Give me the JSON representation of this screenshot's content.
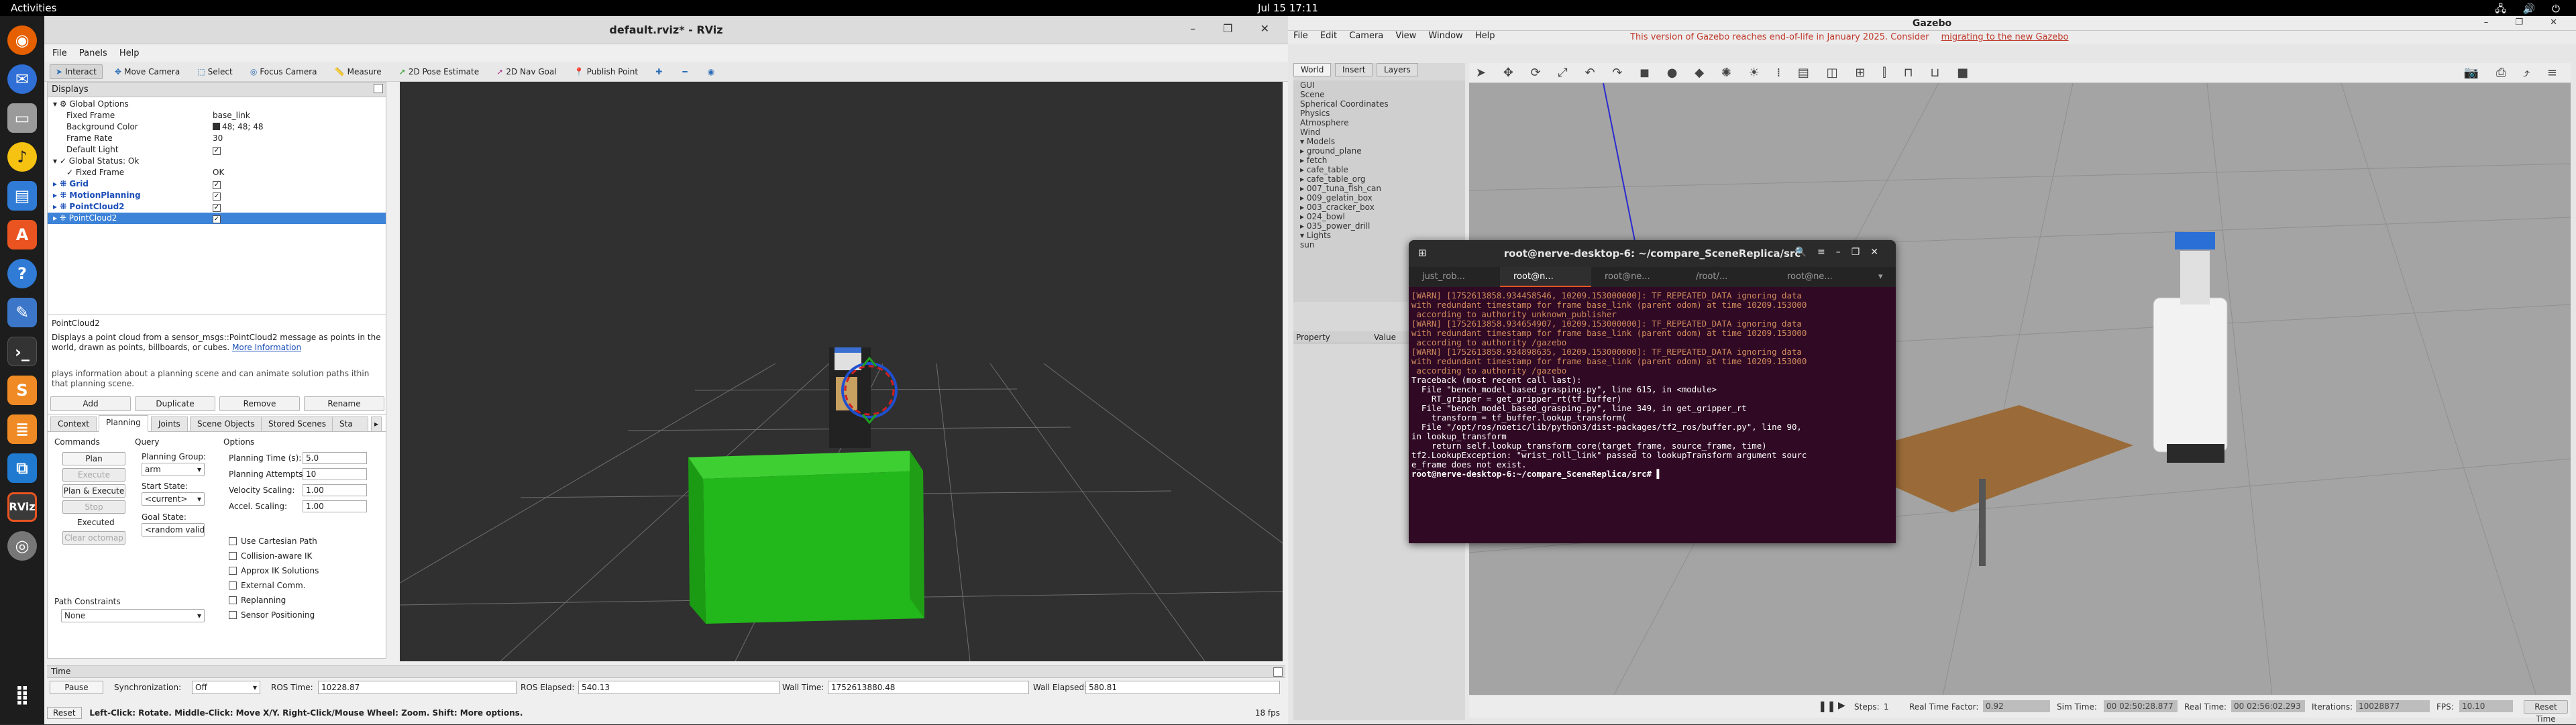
{
  "topbar": {
    "activities": "Activities",
    "clock": "Jul 15  17:11",
    "tray": "🖧 🔊 ⏻"
  },
  "dock": [
    "firefox-icon",
    "thunderbird-icon",
    "files-icon",
    "rhythmbox-icon",
    "writer-icon",
    "software-icon",
    "help-icon",
    "editor-icon",
    "terminal-icon",
    "sublime-icon",
    "stack-icon",
    "vscode-icon",
    "rviz-icon",
    "disk-icon",
    "apps-grid-icon"
  ],
  "rviz": {
    "title": "default.rviz* - RViz",
    "window_controls": "– ❐ ✕",
    "menu": [
      "File",
      "Panels",
      "Help"
    ],
    "tools": [
      {
        "icon": "➤",
        "label": "Interact"
      },
      {
        "icon": "✥",
        "label": "Move Camera"
      },
      {
        "icon": "⬚",
        "label": "Select"
      },
      {
        "icon": "◎",
        "label": "Focus Camera"
      },
      {
        "icon": "📏",
        "label": "Measure"
      },
      {
        "icon": "➚",
        "label": "2D Pose Estimate"
      },
      {
        "icon": "➚",
        "label": "2D Nav Goal"
      },
      {
        "icon": "📍",
        "label": "Publish Point"
      },
      {
        "icon": "✚",
        "label": ""
      },
      {
        "icon": "━",
        "label": ""
      },
      {
        "icon": "◉",
        "label": ""
      }
    ],
    "displays_title": "Displays",
    "tree": [
      {
        "name": "▾ ⚙ Global Options",
        "value": "",
        "ind": 0
      },
      {
        "name": "Fixed Frame",
        "value": "base_link",
        "ind": 2
      },
      {
        "name": "Background Color",
        "value": "48; 48; 48",
        "ind": 2,
        "swatch": true
      },
      {
        "name": "Frame Rate",
        "value": "30",
        "ind": 2
      },
      {
        "name": "Default Light",
        "value": "✓",
        "ind": 2,
        "check": true
      },
      {
        "name": "▾ ✓ Global Status: Ok",
        "value": "",
        "ind": 0
      },
      {
        "name": "✓ Fixed Frame",
        "value": "OK",
        "ind": 2
      },
      {
        "name": "▸ ⁜ Grid",
        "value": "✓",
        "ind": 0,
        "check": true,
        "blue": true
      },
      {
        "name": "▸ ⁜ MotionPlanning",
        "value": "✓",
        "ind": 0,
        "check": true,
        "blue": true
      },
      {
        "name": "▸ ⁜ PointCloud2",
        "value": "✓",
        "ind": 0,
        "check": true,
        "blue": true
      },
      {
        "name": "▸ ⁜ PointCloud2",
        "value": "✓",
        "ind": 0,
        "check": true,
        "sel": true
      }
    ],
    "desc_title": "PointCloud2",
    "desc_text": "Displays a point cloud from a sensor_msgs::PointCloud2 message as points in the world, drawn as points, billboards, or cubes.",
    "desc_link": "More Information",
    "desc_extra": "plays information about a planning scene and can animate solution paths ithin that planning scene.",
    "buttons": [
      "Add",
      "Duplicate",
      "Remove",
      "Rename"
    ],
    "mp_title": "MotionPlanning",
    "tabs": [
      "Context",
      "Planning",
      "Joints",
      "Scene Objects",
      "Stored Scenes",
      "Sta"
    ],
    "commands": {
      "title": "Commands",
      "plan": "Plan",
      "execute": "Execute",
      "plan_exec": "Plan & Execute",
      "stop": "Stop",
      "executed": "Executed",
      "clear": "Clear octomap"
    },
    "query": {
      "title": "Query",
      "group_label": "Planning Group:",
      "group": "arm",
      "start_label": "Start State:",
      "start": "<current>",
      "goal_label": "Goal State:",
      "goal": "<random valid>"
    },
    "options": {
      "title": "Options",
      "time_label": "Planning Time (s):",
      "time": "5.0",
      "attempts_label": "Planning Attempts:",
      "attempts": "10",
      "vel_label": "Velocity Scaling:",
      "vel": "1.00",
      "acc_label": "Accel. Scaling:",
      "acc": "1.00",
      "checks": [
        "Use Cartesian Path",
        "Collision-aware IK",
        "Approx IK Solutions",
        "External Comm.",
        "Replanning",
        "Sensor Positioning"
      ]
    },
    "path_constraints_label": "Path Constraints",
    "path_constraints": "None",
    "time_title": "Time",
    "time": {
      "pause": "Pause",
      "sync_label": "Synchronization:",
      "sync": "Off",
      "ros_time_label": "ROS Time:",
      "ros_time": "10228.87",
      "ros_elapsed_label": "ROS Elapsed:",
      "ros_elapsed": "540.13",
      "wall_time_label": "Wall Time:",
      "wall_time": "1752613880.48",
      "wall_elapsed_label": "Wall Elapsed:",
      "wall_elapsed": "580.81"
    },
    "status": {
      "reset": "Reset",
      "help_html": "Left-Click: Rotate. Middle-Click: Move X/Y. Right-Click/Mouse Wheel: Zoom. Shift: More options.",
      "fps": "18 fps"
    }
  },
  "gazebo": {
    "title": "Gazebo",
    "window_controls": "– ❐ ✕",
    "menu": [
      "File",
      "Edit",
      "Camera",
      "View",
      "Window",
      "Help"
    ],
    "warning": "This version of Gazebo reaches end-of-life in January 2025. Consider ",
    "warning_link": "migrating to the new Gazebo",
    "tabs": [
      "World",
      "Insert",
      "Layers"
    ],
    "tree": [
      "GUI",
      "Scene",
      "Spherical Coordinates",
      "Physics",
      "Atmosphere",
      "Wind",
      "▾ Models",
      "  ▸ ground_plane",
      "  ▸ fetch",
      "  ▸ cafe_table",
      "  ▸ cafe_table_org",
      "  ▸ 007_tuna_fish_can",
      "  ▸ 009_gelatin_box",
      "  ▸ 003_cracker_box",
      "  ▸ 024_bowl",
      "  ▸ 035_power_drill",
      "▾ Lights",
      "    sun"
    ],
    "prop_label": "Property",
    "value_label": "Value",
    "toolbar": "➤ ✥ ⟳ ⤢ ↶ ↷  ◼ ● ◆ ✺ ☀ ⁞  ▤ ◫ ⊞ ⫿ ⊓ ⊔ ■",
    "toolbar_right": "📷 ⎙ ⤴ ≡",
    "bottom": {
      "steps_label": "Steps:",
      "steps": "1",
      "rtf_label": "Real Time Factor:",
      "rtf": "0.92",
      "sim_label": "Sim Time:",
      "sim": "00 02:50:28.877",
      "real_label": "Real Time:",
      "real": "00 02:56:02.293",
      "iter_label": "Iterations:",
      "iter": "10028877",
      "fps_label": "FPS:",
      "fps": "10.10",
      "reset": "Reset Time"
    }
  },
  "terminal": {
    "title": "root@nerve-desktop-6: ~/compare_SceneReplica/src",
    "tabs": [
      "just_rob...",
      "root@n...",
      "root@ne...",
      "/root/...",
      "root@ne..."
    ],
    "lines": [
      {
        "c": "w",
        "t": "[WARN] [1752613858.934458546, 10209.153000000]: TF_REPEATED_DATA ignoring data"
      },
      {
        "c": "w",
        "t": "with redundant timestamp for frame base_link (parent odom) at time 10209.153000"
      },
      {
        "c": "w",
        "t": " according to authority unknown_publisher"
      },
      {
        "c": "w",
        "t": "[WARN] [1752613858.934654907, 10209.153000000]: TF_REPEATED_DATA ignoring data"
      },
      {
        "c": "w",
        "t": "with redundant timestamp for frame base_link (parent odom) at time 10209.153000"
      },
      {
        "c": "w",
        "t": " according to authority /gazebo"
      },
      {
        "c": "w",
        "t": "[WARN] [1752613858.934898635, 10209.153000000]: TF_REPEATED_DATA ignoring data"
      },
      {
        "c": "w",
        "t": "with redundant timestamp for frame base_link (parent odom) at time 10209.153000"
      },
      {
        "c": "w",
        "t": " according to authority /gazebo"
      },
      {
        "c": "n",
        "t": "Traceback (most recent call last):"
      },
      {
        "c": "n",
        "t": "  File \"bench_model_based_grasping.py\", line 615, in <module>"
      },
      {
        "c": "n",
        "t": "    RT_gripper = get_gripper_rt(tf_buffer)"
      },
      {
        "c": "n",
        "t": "  File \"bench_model_based_grasping.py\", line 349, in get_gripper_rt"
      },
      {
        "c": "n",
        "t": "    transform = tf_buffer.lookup_transform("
      },
      {
        "c": "n",
        "t": "  File \"/opt/ros/noetic/lib/python3/dist-packages/tf2_ros/buffer.py\", line 90,"
      },
      {
        "c": "n",
        "t": "in lookup_transform"
      },
      {
        "c": "n",
        "t": "    return self.lookup_transform_core(target_frame, source_frame, time)"
      },
      {
        "c": "n",
        "t": "tf2.LookupException: \"wrist_roll_link\" passed to lookupTransform argument sourc"
      },
      {
        "c": "n",
        "t": "e_frame does not exist."
      },
      {
        "c": "p",
        "t": "root@nerve-desktop-6:~/compare_SceneReplica/src# ▌"
      }
    ]
  }
}
